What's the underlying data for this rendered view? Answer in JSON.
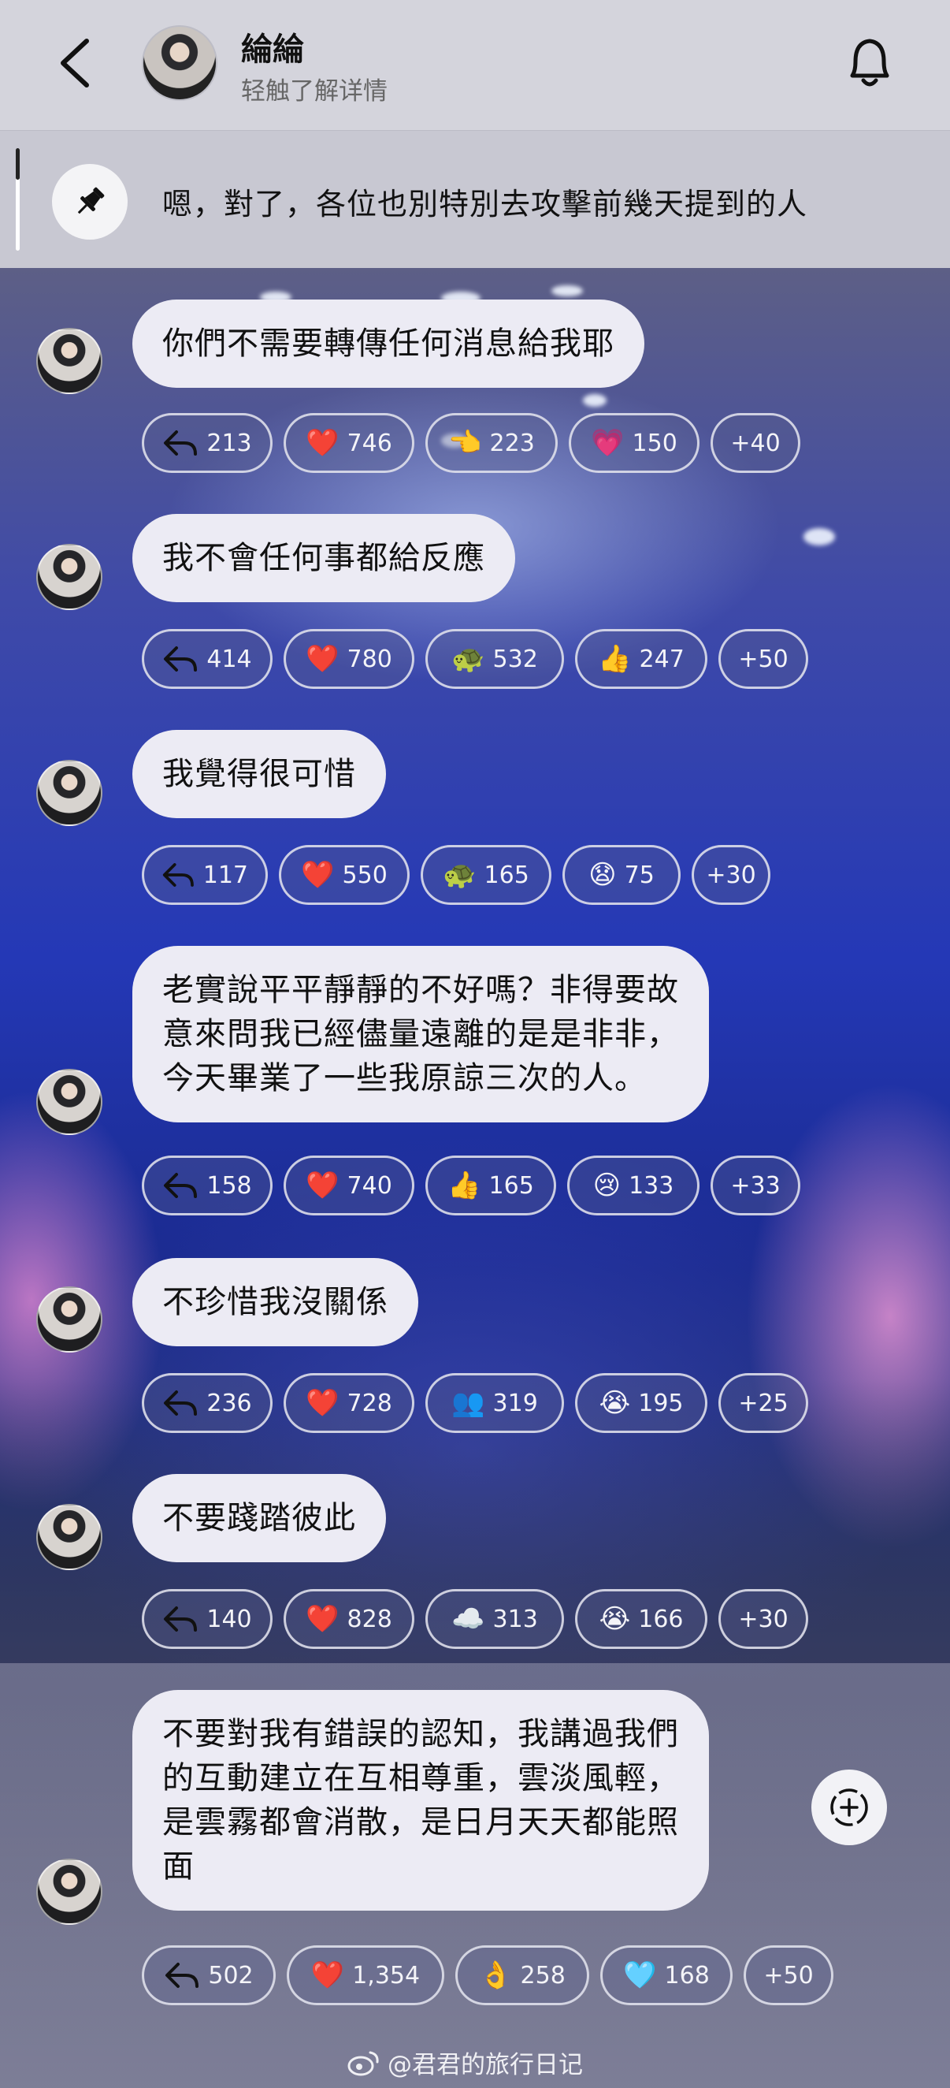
{
  "header": {
    "name": "綸綸",
    "subtitle": "轻触了解详情"
  },
  "pinned": {
    "text": "嗯，對了，各位也別特別去攻擊前幾天提到的人"
  },
  "messages": [
    {
      "text": "你們不需要轉傳任何消息給我耶",
      "reactions": [
        {
          "icon": "reply-icon",
          "emoji": "",
          "count": "213"
        },
        {
          "icon": "red-heart-icon",
          "emoji": "❤️",
          "count": "746"
        },
        {
          "icon": "pointing-hand-icon",
          "emoji": "👈",
          "count": "223"
        },
        {
          "icon": "pink-heart-icon",
          "emoji": "💗",
          "count": "150"
        },
        {
          "icon": "more-reactions",
          "emoji": "",
          "count": "+40"
        }
      ]
    },
    {
      "text": "我不會任何事都給反應",
      "reactions": [
        {
          "icon": "reply-icon",
          "emoji": "",
          "count": "414"
        },
        {
          "icon": "red-heart-icon",
          "emoji": "❤️",
          "count": "780"
        },
        {
          "icon": "turtle-icon",
          "emoji": "🐢",
          "count": "532"
        },
        {
          "icon": "thumbs-up-icon",
          "emoji": "👍",
          "count": "247"
        },
        {
          "icon": "more-reactions",
          "emoji": "",
          "count": "+50"
        }
      ]
    },
    {
      "text": "我覺得很可惜",
      "reactions": [
        {
          "icon": "reply-icon",
          "emoji": "",
          "count": "117"
        },
        {
          "icon": "red-heart-icon",
          "emoji": "❤️",
          "count": "550"
        },
        {
          "icon": "turtle-icon",
          "emoji": "🐢",
          "count": "165"
        },
        {
          "icon": "worried-face-icon",
          "emoji": "😧",
          "count": "75"
        },
        {
          "icon": "more-reactions",
          "emoji": "",
          "count": "+30"
        }
      ]
    },
    {
      "text": "老實說平平靜靜的不好嗎？非得要故\n意來問我已經儘量遠離的是是非非，\n今天畢業了一些我原諒三次的人。",
      "reactions": [
        {
          "icon": "reply-icon",
          "emoji": "",
          "count": "158"
        },
        {
          "icon": "red-heart-icon",
          "emoji": "❤️",
          "count": "740"
        },
        {
          "icon": "thumbs-up-icon",
          "emoji": "👍",
          "count": "165"
        },
        {
          "icon": "crying-face-icon",
          "emoji": "😢",
          "count": "133"
        },
        {
          "icon": "more-reactions",
          "emoji": "",
          "count": "+33"
        }
      ]
    },
    {
      "text": "不珍惜我沒關係",
      "reactions": [
        {
          "icon": "reply-icon",
          "emoji": "",
          "count": "236"
        },
        {
          "icon": "red-heart-icon",
          "emoji": "❤️",
          "count": "728"
        },
        {
          "icon": "group-icon",
          "emoji": "👥",
          "count": "319"
        },
        {
          "icon": "sobbing-face-icon",
          "emoji": "😭",
          "count": "195"
        },
        {
          "icon": "more-reactions",
          "emoji": "",
          "count": "+25"
        }
      ]
    },
    {
      "text": "不要踐踏彼此",
      "reactions": [
        {
          "icon": "reply-icon",
          "emoji": "",
          "count": "140"
        },
        {
          "icon": "red-heart-icon",
          "emoji": "❤️",
          "count": "828"
        },
        {
          "icon": "cloud-icon",
          "emoji": "☁️",
          "count": "313"
        },
        {
          "icon": "sobbing-face-icon",
          "emoji": "😭",
          "count": "166"
        },
        {
          "icon": "more-reactions",
          "emoji": "",
          "count": "+30"
        }
      ]
    },
    {
      "text": "不要對我有錯誤的認知，我講過我們\n的互動建立在互相尊重，雲淡風輕，\n是雲霧都會消散，是日月天天都能照\n面",
      "reactions": [
        {
          "icon": "reply-icon",
          "emoji": "",
          "count": "502"
        },
        {
          "icon": "red-heart-icon",
          "emoji": "❤️",
          "count": "1,354"
        },
        {
          "icon": "ok-hand-icon",
          "emoji": "👌",
          "count": "258"
        },
        {
          "icon": "blue-heart-icon",
          "emoji": "🩵",
          "count": "168"
        },
        {
          "icon": "more-reactions",
          "emoji": "",
          "count": "+50"
        }
      ]
    }
  ],
  "watermark": {
    "text": "@君君的旅行日记"
  },
  "colors": {
    "header_bg": "#d4d4dc",
    "bubble_bg": "#ecebf4",
    "stage_blue": "#2438b6",
    "stage_pink": "#ff9fdc"
  }
}
